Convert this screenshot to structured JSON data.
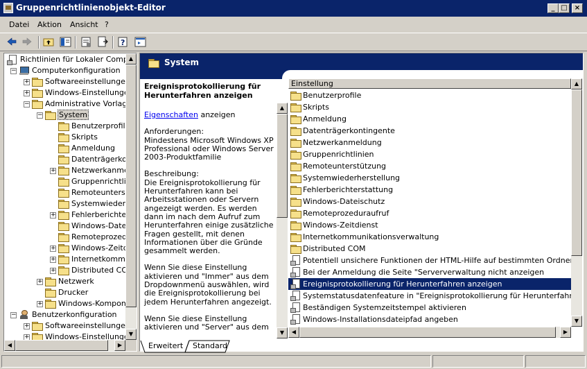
{
  "window": {
    "title": "Gruppenrichtlinienobjekt-Editor",
    "controls": {
      "minimize": "_",
      "maximize": "□",
      "close": "×"
    }
  },
  "menu": [
    "Datei",
    "Aktion",
    "Ansicht",
    "?"
  ],
  "toolbar": {
    "buttons": [
      "back-arrow-icon",
      "forward-arrow-icon",
      "up-folder-icon",
      "show-hide-tree-icon",
      "properties-icon",
      "export-list-icon",
      "help-icon",
      "console-tree-icon"
    ]
  },
  "tree": {
    "items": [
      {
        "label": "Richtlinien für Lokaler Computer",
        "depth": 0,
        "icon": "policy",
        "expander": ""
      },
      {
        "label": "Computerkonfiguration",
        "depth": 1,
        "icon": "computer",
        "expander": "-"
      },
      {
        "label": "Softwareeinstellungen",
        "depth": 2,
        "icon": "folder",
        "expander": "+"
      },
      {
        "label": "Windows-Einstellungen",
        "depth": 2,
        "icon": "folder",
        "expander": "+"
      },
      {
        "label": "Administrative Vorlagen",
        "depth": 2,
        "icon": "folder",
        "expander": "-"
      },
      {
        "label": "System",
        "depth": 3,
        "icon": "folder",
        "expander": "-",
        "selected": true
      },
      {
        "label": "Benutzerprofile",
        "depth": 4,
        "icon": "folder",
        "expander": ""
      },
      {
        "label": "Skripts",
        "depth": 4,
        "icon": "folder",
        "expander": ""
      },
      {
        "label": "Anmeldung",
        "depth": 4,
        "icon": "folder",
        "expander": ""
      },
      {
        "label": "Datenträgerkontingente",
        "depth": 4,
        "icon": "folder",
        "expander": ""
      },
      {
        "label": "Netzwerkanmeldung",
        "depth": 4,
        "icon": "folder",
        "expander": "+"
      },
      {
        "label": "Gruppenrichtlinien",
        "depth": 4,
        "icon": "folder",
        "expander": ""
      },
      {
        "label": "Remoteunterstützung",
        "depth": 4,
        "icon": "folder",
        "expander": ""
      },
      {
        "label": "Systemwiederherstellung",
        "depth": 4,
        "icon": "folder",
        "expander": ""
      },
      {
        "label": "Fehlerberichterstattung",
        "depth": 4,
        "icon": "folder",
        "expander": "+"
      },
      {
        "label": "Windows-Dateischutz",
        "depth": 4,
        "icon": "folder",
        "expander": ""
      },
      {
        "label": "Remoteprozeduraufruf",
        "depth": 4,
        "icon": "folder",
        "expander": ""
      },
      {
        "label": "Windows-Zeitdienst",
        "depth": 4,
        "icon": "folder",
        "expander": "+"
      },
      {
        "label": "Internetkommunikationsverwaltung",
        "depth": 4,
        "icon": "folder",
        "expander": "+"
      },
      {
        "label": "Distributed COM",
        "depth": 4,
        "icon": "folder",
        "expander": "+"
      },
      {
        "label": "Netzwerk",
        "depth": 3,
        "icon": "folder",
        "expander": "+"
      },
      {
        "label": "Drucker",
        "depth": 3,
        "icon": "folder",
        "expander": ""
      },
      {
        "label": "Windows-Komponenten",
        "depth": 3,
        "icon": "folder",
        "expander": "+"
      },
      {
        "label": "Benutzerkonfiguration",
        "depth": 1,
        "icon": "user",
        "expander": "-"
      },
      {
        "label": "Softwareeinstellungen",
        "depth": 2,
        "icon": "folder",
        "expander": "+"
      },
      {
        "label": "Windows-Einstellungen",
        "depth": 2,
        "icon": "folder",
        "expander": "+"
      }
    ]
  },
  "header": {
    "title": "System"
  },
  "description": {
    "title": "Ereignisprotokollierung für Herunterfahren anzeigen",
    "link": "Eigenschaften",
    "link_suffix": " anzeigen",
    "requirements_label": "Anforderungen:",
    "requirements": "Mindestens Microsoft Windows XP Professional oder Windows Server 2003-Produktfamilie",
    "description_label": "Beschreibung:",
    "description": "Die Ereignisprotokollierung für Herunterfahren kann bei Arbeitsstationen oder Servern angezeigt werden.   Es werden dann im nach dem Aufruf zum Herunterfahren einige zusätzliche Fragen gestellt, mit denen Informationen über die Gründe gesammelt werden.",
    "para2": "Wenn Sie diese Einstellung aktivieren und \"Immer\" aus dem Dropdownmenü auswählen, wird die Ereignisprotokollierung bei jedem Herunterfahren angezeigt.",
    "para3": "Wenn Sie diese Einstellung aktivieren und \"Server\" aus dem"
  },
  "list": {
    "column_header": "Einstellung",
    "rows": [
      {
        "label": "Benutzerprofile",
        "type": "folder"
      },
      {
        "label": "Skripts",
        "type": "folder"
      },
      {
        "label": "Anmeldung",
        "type": "folder"
      },
      {
        "label": "Datenträgerkontingente",
        "type": "folder"
      },
      {
        "label": "Netzwerkanmeldung",
        "type": "folder"
      },
      {
        "label": "Gruppenrichtlinien",
        "type": "folder"
      },
      {
        "label": "Remoteunterstützung",
        "type": "folder"
      },
      {
        "label": "Systemwiederherstellung",
        "type": "folder"
      },
      {
        "label": "Fehlerberichterstattung",
        "type": "folder"
      },
      {
        "label": "Windows-Dateischutz",
        "type": "folder"
      },
      {
        "label": "Remoteprozeduraufruf",
        "type": "folder"
      },
      {
        "label": "Windows-Zeitdienst",
        "type": "folder"
      },
      {
        "label": "Internetkommunikationsverwaltung",
        "type": "folder"
      },
      {
        "label": "Distributed COM",
        "type": "folder"
      },
      {
        "label": "Potentiell unsichere Funktionen der HTML-Hilfe auf bestimmten Ordnern einschränken",
        "type": "policy"
      },
      {
        "label": "Bei der Anmeldung die Seite \"Serververwaltung nicht anzeigen",
        "type": "policy"
      },
      {
        "label": "Ereignisprotokollierung für Herunterfahren anzeigen",
        "type": "policy",
        "selected": true
      },
      {
        "label": "Systemstatusdatenfeature in \"Ereignisprotokollierung für Herunterfahren\" aktivieren",
        "type": "policy"
      },
      {
        "label": "Beständigen Systemzeitstempel aktivieren",
        "type": "policy"
      },
      {
        "label": "Windows-Installationsdateipfad angeben",
        "type": "policy"
      }
    ]
  },
  "tabs": [
    "Erweitert",
    "Standard"
  ],
  "colors": {
    "titlebar": "#0a246a",
    "selection": "#0a246a",
    "window_bg": "#d4d0c8",
    "link": "#0000ee"
  }
}
